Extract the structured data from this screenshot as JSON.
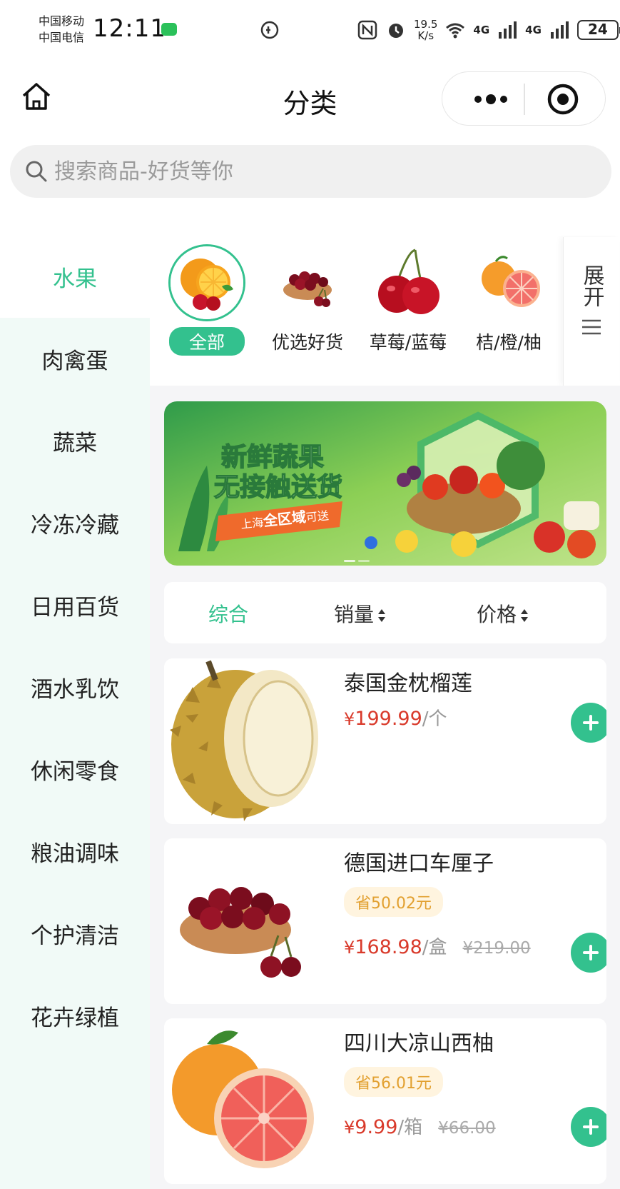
{
  "status_bar": {
    "carrier1": "中国移动",
    "carrier2": "中国电信",
    "time": "12:11",
    "net_speed_value": "19.5",
    "net_speed_unit": "K/s",
    "net_label": "4G",
    "battery": "24"
  },
  "nav": {
    "title": "分类"
  },
  "search": {
    "placeholder": "搜索商品-好货等你"
  },
  "sidebar": {
    "items": [
      {
        "label": "水果"
      },
      {
        "label": "肉禽蛋"
      },
      {
        "label": "蔬菜"
      },
      {
        "label": "冷冻冷藏"
      },
      {
        "label": "日用百货"
      },
      {
        "label": "酒水乳饮"
      },
      {
        "label": "休闲零食"
      },
      {
        "label": "粮油调味"
      },
      {
        "label": "个护清洁"
      },
      {
        "label": "花卉绿植"
      }
    ]
  },
  "subcategories": {
    "items": [
      {
        "label": "全部"
      },
      {
        "label": "优选好货"
      },
      {
        "label": "草莓/蓝莓"
      },
      {
        "label": "桔/橙/柚"
      }
    ],
    "expand_label": "展开"
  },
  "banner": {
    "headline1": "新鲜蔬果",
    "headline2": "无接触送货",
    "tag_prefix": "上海",
    "tag_em": "全区域",
    "tag_suffix": "可送"
  },
  "sort": {
    "overall": "综合",
    "sales": "销量",
    "price": "价格"
  },
  "products": [
    {
      "name": "泰国金枕榴莲",
      "currency": "¥",
      "price": "199.99",
      "unit": "/个",
      "save": "",
      "original": ""
    },
    {
      "name": "德国进口车厘子",
      "currency": "¥",
      "price": "168.98",
      "unit": "/盒",
      "save": "省50.02元",
      "original": "¥219.00"
    },
    {
      "name": "四川大凉山西柚",
      "currency": "¥",
      "price": "9.99",
      "unit": "/箱",
      "save": "省56.01元",
      "original": "¥66.00"
    }
  ],
  "colors": {
    "accent": "#33c18e",
    "price": "#d93a2b",
    "save_bg": "#fff4df",
    "save_text": "#e2a030"
  }
}
